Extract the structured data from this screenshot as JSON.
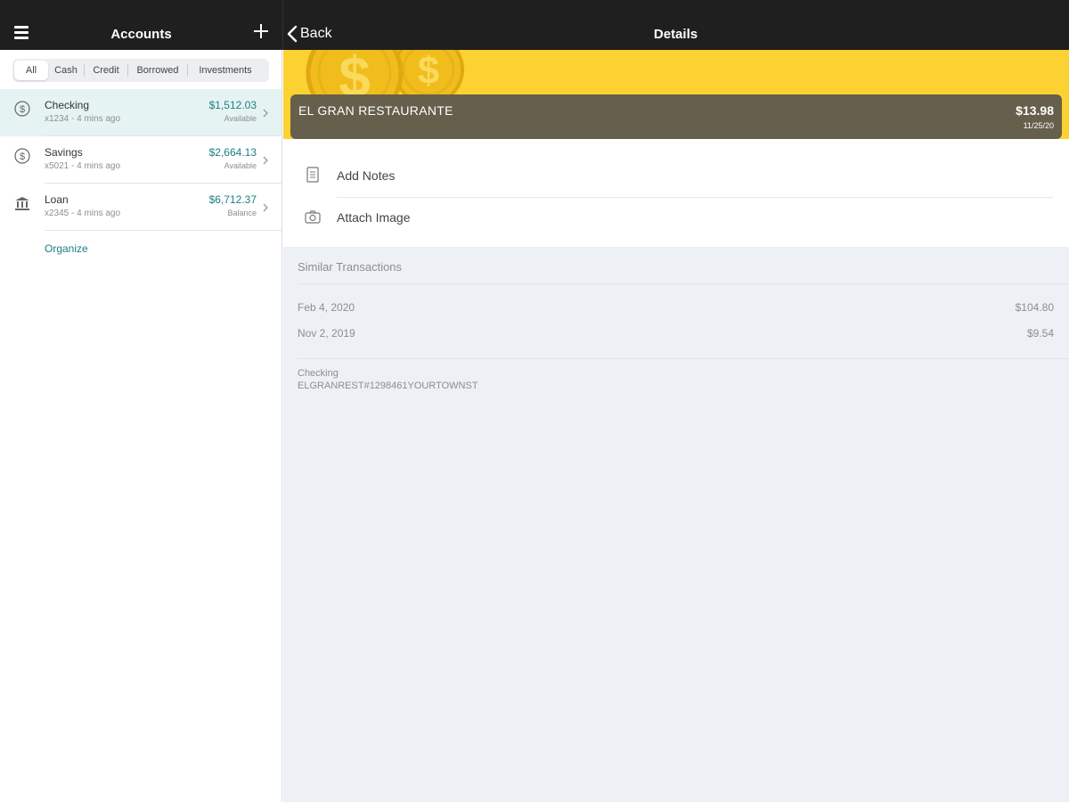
{
  "header": {
    "accounts_title": "Accounts",
    "back_label": "Back",
    "details_title": "Details"
  },
  "filters": [
    "All",
    "Cash",
    "Credit",
    "Borrowed",
    "Investments"
  ],
  "accounts": [
    {
      "name": "Checking",
      "sub": "x1234 - 4 mins ago",
      "amount": "$1,512.03",
      "label": "Available",
      "icon": "dollar-circle-icon"
    },
    {
      "name": "Savings",
      "sub": "x5021 - 4 mins ago",
      "amount": "$2,664.13",
      "label": "Available",
      "icon": "dollar-circle-icon"
    },
    {
      "name": "Loan",
      "sub": "x2345 - 4 mins ago",
      "amount": "$6,712.37",
      "label": "Balance",
      "icon": "bank-icon"
    }
  ],
  "organize_label": "Organize",
  "transaction": {
    "name": "EL GRAN RESTAURANTE",
    "amount": "$13.98",
    "date": "11/25/20"
  },
  "actions": {
    "add_notes": "Add Notes",
    "attach_image": "Attach Image"
  },
  "similar": {
    "title": "Similar Transactions",
    "rows": [
      {
        "date": "Feb 4, 2020",
        "amount": "$104.80"
      },
      {
        "date": "Nov 2, 2019",
        "amount": "$9.54"
      }
    ]
  },
  "account_info": {
    "account": "Checking",
    "description": "ELGRANREST#1298461YOURTOWNST"
  },
  "colors": {
    "topbar": "#1f1f1f",
    "accent": "#1d7e82",
    "banner": "#fcd132",
    "card": "#655f4c"
  }
}
